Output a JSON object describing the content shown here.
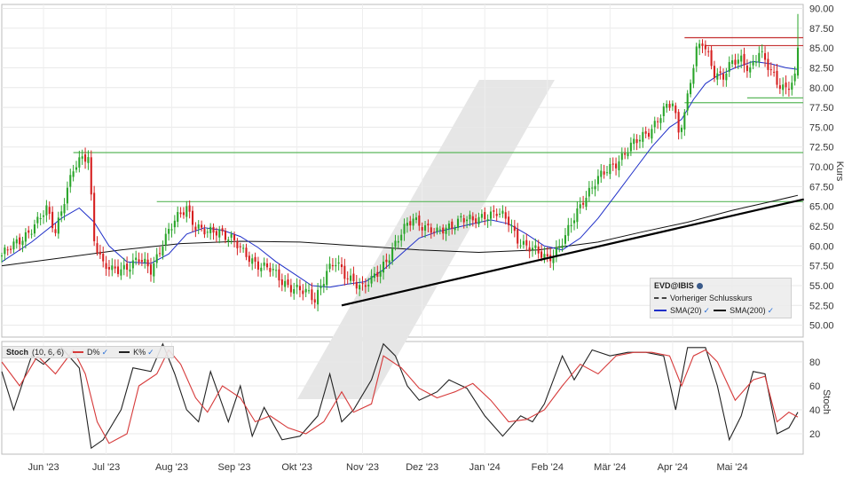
{
  "chart_data": [
    {
      "type": "candlestick",
      "symbol": "EVD@IBIS",
      "ylabel": "Kurs",
      "ylim": [
        48.5,
        90.5
      ],
      "yticks": [
        "50.00",
        "52.50",
        "55.00",
        "57.50",
        "60.00",
        "62.50",
        "65.00",
        "67.50",
        "70.00",
        "72.50",
        "75.00",
        "77.50",
        "80.00",
        "82.50",
        "85.00",
        "87.50",
        "90.00"
      ],
      "months": [
        "Jun '23",
        "Jul '23",
        "Aug '23",
        "Sep '23",
        "Okt '23",
        "Nov '23",
        "Dez '23",
        "Jan '24",
        "Feb '24",
        "Mär '24",
        "Apr '24",
        "Mai '24"
      ],
      "close_trend": [
        [
          0,
          58.8
        ],
        [
          4,
          60.0
        ],
        [
          8,
          61.5
        ],
        [
          12,
          63.0
        ],
        [
          15,
          64.5
        ],
        [
          18,
          62.0
        ],
        [
          21,
          66.0
        ],
        [
          24,
          69.5
        ],
        [
          27,
          71.0
        ],
        [
          29,
          71.5
        ],
        [
          31,
          61.0
        ],
        [
          34,
          57.5
        ],
        [
          37,
          56.8
        ],
        [
          42,
          57.5
        ],
        [
          46,
          58.2
        ],
        [
          50,
          57.0
        ],
        [
          54,
          60.5
        ],
        [
          58,
          63.0
        ],
        [
          62,
          65.0
        ],
        [
          65,
          62.5
        ],
        [
          69,
          61.5
        ],
        [
          73,
          62.0
        ],
        [
          77,
          61.0
        ],
        [
          81,
          59.0
        ],
        [
          85,
          58.0
        ],
        [
          90,
          57.0
        ],
        [
          94,
          55.5
        ],
        [
          98,
          54.8
        ],
        [
          102,
          54.0
        ],
        [
          105,
          53.2
        ],
        [
          109,
          57.0
        ],
        [
          112,
          57.8
        ],
        [
          115,
          56.2
        ],
        [
          118,
          55.8
        ],
        [
          121,
          54.8
        ],
        [
          124,
          55.5
        ],
        [
          127,
          57.0
        ],
        [
          130,
          59.0
        ],
        [
          134,
          61.5
        ],
        [
          138,
          63.5
        ],
        [
          142,
          62.5
        ],
        [
          146,
          61.5
        ],
        [
          150,
          62.5
        ],
        [
          154,
          63.5
        ],
        [
          158,
          63.0
        ],
        [
          162,
          64.0
        ],
        [
          166,
          64.2
        ],
        [
          170,
          63.0
        ],
        [
          173,
          61.0
        ],
        [
          176,
          60.0
        ],
        [
          180,
          59.0
        ],
        [
          183,
          58.5
        ],
        [
          186,
          59.5
        ],
        [
          189,
          61.0
        ],
        [
          192,
          63.5
        ],
        [
          195,
          66.0
        ],
        [
          199,
          68.0
        ],
        [
          203,
          69.5
        ],
        [
          207,
          71.0
        ],
        [
          211,
          72.5
        ],
        [
          214,
          73.5
        ],
        [
          218,
          75.0
        ],
        [
          222,
          77.0
        ],
        [
          225,
          78.0
        ],
        [
          227,
          74.5
        ],
        [
          229,
          77.0
        ],
        [
          231,
          81.0
        ],
        [
          233,
          84.5
        ],
        [
          235,
          85.5
        ],
        [
          237,
          84.0
        ],
        [
          239,
          82.0
        ],
        [
          242,
          81.5
        ],
        [
          245,
          83.0
        ],
        [
          248,
          83.5
        ],
        [
          251,
          82.5
        ],
        [
          254,
          84.5
        ],
        [
          257,
          82.5
        ],
        [
          260,
          80.8
        ],
        [
          263,
          80.0
        ],
        [
          266,
          81.0
        ],
        [
          267,
          84.8
        ]
      ],
      "sma20": [
        [
          0,
          58.0
        ],
        [
          10,
          60.5
        ],
        [
          20,
          63.5
        ],
        [
          26,
          64.8
        ],
        [
          31,
          63.0
        ],
        [
          36,
          60.0
        ],
        [
          42,
          58.0
        ],
        [
          50,
          57.8
        ],
        [
          56,
          59.0
        ],
        [
          62,
          61.5
        ],
        [
          68,
          62.3
        ],
        [
          74,
          62.0
        ],
        [
          80,
          61.2
        ],
        [
          86,
          59.8
        ],
        [
          92,
          58.0
        ],
        [
          98,
          56.5
        ],
        [
          104,
          55.0
        ],
        [
          110,
          54.8
        ],
        [
          116,
          55.2
        ],
        [
          122,
          55.5
        ],
        [
          128,
          57.0
        ],
        [
          134,
          59.0
        ],
        [
          140,
          61.0
        ],
        [
          146,
          61.8
        ],
        [
          152,
          62.3
        ],
        [
          158,
          62.8
        ],
        [
          164,
          63.3
        ],
        [
          170,
          62.8
        ],
        [
          176,
          61.5
        ],
        [
          182,
          60.0
        ],
        [
          188,
          59.5
        ],
        [
          194,
          61.0
        ],
        [
          200,
          63.5
        ],
        [
          206,
          66.5
        ],
        [
          212,
          69.5
        ],
        [
          218,
          72.5
        ],
        [
          224,
          75.0
        ],
        [
          228,
          76.0
        ],
        [
          232,
          78.5
        ],
        [
          236,
          80.5
        ],
        [
          240,
          81.5
        ],
        [
          246,
          82.5
        ],
        [
          252,
          83.3
        ],
        [
          258,
          83.0
        ],
        [
          263,
          82.5
        ],
        [
          267,
          82.3
        ]
      ],
      "sma200": [
        [
          0,
          57.5
        ],
        [
          20,
          58.5
        ],
        [
          40,
          59.5
        ],
        [
          60,
          60.3
        ],
        [
          80,
          60.6
        ],
        [
          100,
          60.5
        ],
        [
          120,
          60.0
        ],
        [
          140,
          59.5
        ],
        [
          160,
          59.2
        ],
        [
          180,
          59.5
        ],
        [
          200,
          60.5
        ],
        [
          215,
          61.8
        ],
        [
          230,
          63.0
        ],
        [
          245,
          64.5
        ],
        [
          258,
          65.6
        ],
        [
          267,
          66.4
        ]
      ],
      "high_spike": 89.3,
      "prev_close_line": 85.6,
      "resistance_red": [
        86.3,
        85.3
      ],
      "support_green": [
        78.7,
        78.1,
        71.8,
        65.6
      ],
      "trendline": [
        [
          114,
          52.5
        ],
        [
          269,
          65.9
        ]
      ],
      "legend": {
        "title": "EVD@IBIS",
        "prev_close": "Vorheriger Schlusskurs",
        "sma20": "SMA(20)",
        "sma200": "SMA(200)"
      },
      "colors": {
        "up": "#2aa52a",
        "down": "#d62020",
        "sma20": "#1f2fc8",
        "sma200": "#111111",
        "red_line": "#c43030",
        "green_line": "#5cb85c",
        "trend": "#000000"
      }
    },
    {
      "type": "line",
      "name": "Stoch (10, 6, 6)",
      "ylabel": "Stoch",
      "ylim": [
        3,
        97
      ],
      "yticks": [
        "20",
        "40",
        "60",
        "80"
      ],
      "series": [
        {
          "name": "D%",
          "color": "#d63a3a",
          "points": [
            [
              0,
              80
            ],
            [
              6,
              60
            ],
            [
              12,
              85
            ],
            [
              18,
              70
            ],
            [
              24,
              90
            ],
            [
              28,
              70
            ],
            [
              32,
              30
            ],
            [
              36,
              12
            ],
            [
              42,
              20
            ],
            [
              46,
              60
            ],
            [
              52,
              70
            ],
            [
              56,
              90
            ],
            [
              60,
              78
            ],
            [
              65,
              50
            ],
            [
              69,
              38
            ],
            [
              74,
              60
            ],
            [
              80,
              50
            ],
            [
              85,
              30
            ],
            [
              90,
              35
            ],
            [
              96,
              25
            ],
            [
              102,
              20
            ],
            [
              108,
              30
            ],
            [
              114,
              55
            ],
            [
              118,
              38
            ],
            [
              124,
              45
            ],
            [
              128,
              85
            ],
            [
              134,
              75
            ],
            [
              140,
              58
            ],
            [
              146,
              50
            ],
            [
              152,
              55
            ],
            [
              158,
              62
            ],
            [
              164,
              48
            ],
            [
              170,
              30
            ],
            [
              176,
              32
            ],
            [
              182,
              40
            ],
            [
              188,
              60
            ],
            [
              194,
              78
            ],
            [
              200,
              70
            ],
            [
              206,
              85
            ],
            [
              212,
              88
            ],
            [
              218,
              88
            ],
            [
              224,
              85
            ],
            [
              228,
              60
            ],
            [
              232,
              85
            ],
            [
              236,
              90
            ],
            [
              240,
              80
            ],
            [
              246,
              48
            ],
            [
              252,
              65
            ],
            [
              256,
              68
            ],
            [
              260,
              30
            ],
            [
              264,
              38
            ],
            [
              267,
              34
            ]
          ]
        },
        {
          "name": "K%",
          "color": "#222222",
          "points": [
            [
              0,
              72
            ],
            [
              4,
              40
            ],
            [
              10,
              85
            ],
            [
              14,
              78
            ],
            [
              20,
              92
            ],
            [
              26,
              75
            ],
            [
              30,
              8
            ],
            [
              34,
              15
            ],
            [
              40,
              40
            ],
            [
              44,
              75
            ],
            [
              50,
              72
            ],
            [
              54,
              95
            ],
            [
              58,
              70
            ],
            [
              62,
              40
            ],
            [
              66,
              30
            ],
            [
              70,
              72
            ],
            [
              76,
              30
            ],
            [
              80,
              60
            ],
            [
              84,
              18
            ],
            [
              88,
              42
            ],
            [
              94,
              15
            ],
            [
              100,
              18
            ],
            [
              106,
              35
            ],
            [
              110,
              70
            ],
            [
              114,
              30
            ],
            [
              118,
              40
            ],
            [
              124,
              65
            ],
            [
              128,
              95
            ],
            [
              132,
              85
            ],
            [
              136,
              60
            ],
            [
              140,
              48
            ],
            [
              146,
              55
            ],
            [
              150,
              65
            ],
            [
              156,
              58
            ],
            [
              162,
              35
            ],
            [
              168,
              18
            ],
            [
              174,
              35
            ],
            [
              178,
              30
            ],
            [
              182,
              45
            ],
            [
              188,
              85
            ],
            [
              192,
              65
            ],
            [
              198,
              90
            ],
            [
              204,
              85
            ],
            [
              210,
              88
            ],
            [
              216,
              88
            ],
            [
              222,
              85
            ],
            [
              226,
              40
            ],
            [
              230,
              92
            ],
            [
              236,
              92
            ],
            [
              240,
              60
            ],
            [
              244,
              15
            ],
            [
              248,
              35
            ],
            [
              252,
              72
            ],
            [
              256,
              70
            ],
            [
              260,
              20
            ],
            [
              264,
              25
            ],
            [
              267,
              38
            ]
          ]
        }
      ]
    }
  ],
  "ui": {
    "stoch_label": "Stoch",
    "stoch_params": "(10, 6, 6)",
    "d_label": "D%",
    "k_label": "K%"
  }
}
